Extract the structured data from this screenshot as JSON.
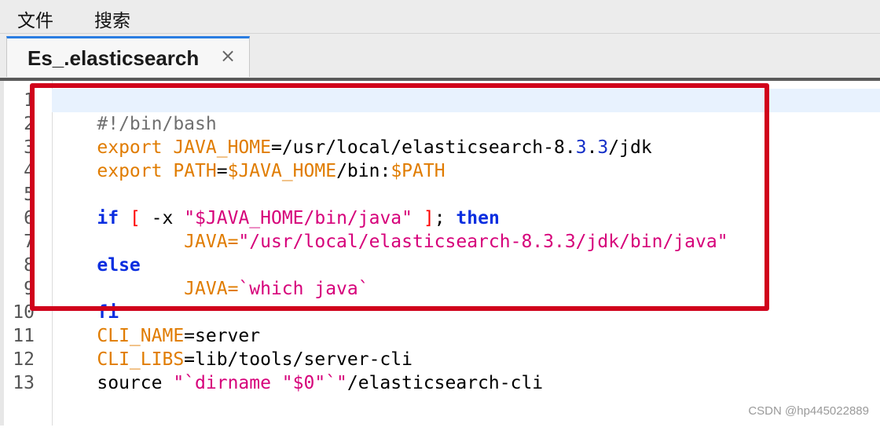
{
  "menu": {
    "file": "文件",
    "search": "搜索"
  },
  "tab": {
    "title": "Es_.elasticsearch",
    "close": "×"
  },
  "line_numbers": [
    "1",
    "2",
    "3",
    "4",
    "5",
    "6",
    "7",
    "8",
    "9",
    "10",
    "11",
    "12",
    "13"
  ],
  "code": {
    "l1": {
      "a": "#!/bin/bash"
    },
    "l2": {
      "a": "export",
      "b": " ",
      "c": "JAVA_HOME",
      "d": "=/usr/local/elasticsearch-8.",
      "e": "3",
      "f": ".",
      "g": "3",
      "h": "/jdk"
    },
    "l3": {
      "a": "export",
      "b": " ",
      "c": "PATH",
      "d": "=",
      "e": "$JAVA_HOME",
      "f": "/bin:",
      "g": "$PATH"
    },
    "l4": {
      "a": ""
    },
    "l5": {
      "a": "if",
      "b": " ",
      "c": "[",
      "d": " -x ",
      "e": "\"$JAVA_HOME/bin/java\"",
      "f": " ",
      "g": "]",
      "h": "; ",
      "i": "then"
    },
    "l6": {
      "a": "        ",
      "b": "JAVA",
      "c": "=",
      "d": "\"/usr/local/elasticsearch-8.3.3/jdk/bin/java\""
    },
    "l7": {
      "a": "else"
    },
    "l8": {
      "a": "        ",
      "b": "JAVA",
      "c": "=",
      "d": "`which java`"
    },
    "l9": {
      "a": "fi"
    },
    "l10": {
      "a": "CLI_NAME",
      "b": "=server"
    },
    "l11": {
      "a": "CLI_LIBS",
      "b": "=lib/tools/server-cli"
    },
    "l12": {
      "a": "source ",
      "b": "\"`dirname \"$0\"`\"",
      "c": "/elasticsearch-cli"
    },
    "l13": {
      "a": ""
    }
  },
  "watermark": "CSDN @hp445022889",
  "colors": {
    "highlight_box": "#d0021b",
    "keyword": "#e07c00",
    "string": "#d6007a",
    "control": "#0a2ee0"
  }
}
